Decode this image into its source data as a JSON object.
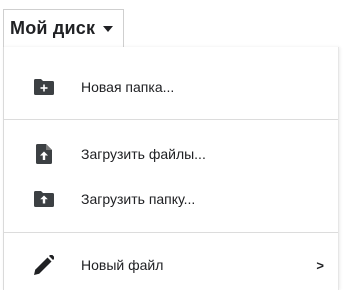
{
  "header": {
    "title": "Мой диск"
  },
  "menu": {
    "items": [
      {
        "label": "Новая папка...",
        "icon": "new-folder-icon"
      },
      {
        "label": "Загрузить файлы...",
        "icon": "file-upload-icon"
      },
      {
        "label": "Загрузить папку...",
        "icon": "folder-upload-icon"
      },
      {
        "label": "Новый файл",
        "icon": "pencil-icon",
        "submenu_arrow": ">"
      }
    ]
  }
}
